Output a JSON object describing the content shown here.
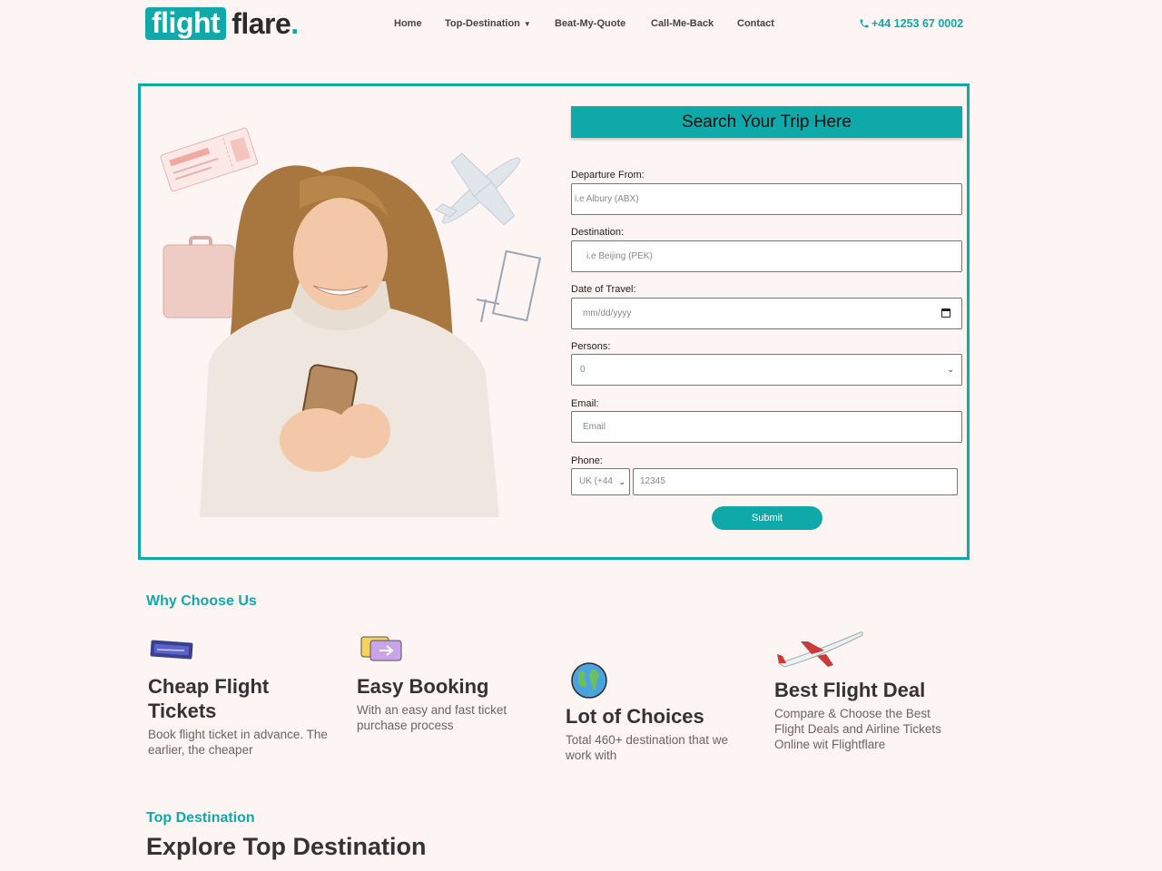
{
  "brand": {
    "logo_box": "flight",
    "logo_text": "flare",
    "logo_dot": "."
  },
  "nav": {
    "items": [
      "Home",
      "Top-Destination",
      "Beat-My-Quote",
      "Call-Me-Back",
      "Contact"
    ],
    "phone": "+44 1253 67 0002",
    "phone_icon": "phone-icon"
  },
  "form": {
    "title": "Search Your Trip Here",
    "departure_label": "Departure From:",
    "departure_placeholder": "i.e Albury (ABX)",
    "destination_label": "Destination:",
    "destination_placeholder": "i.e Beijing (PEK)",
    "date_label": "Date of Travel:",
    "date_placeholder": "mm/dd/yyyy",
    "persons_label": "Persons:",
    "persons_value": "0",
    "email_label": "Email:",
    "email_placeholder": "Email",
    "phone_label": "Phone:",
    "country_code": "UK (+44",
    "phone_placeholder": "12345",
    "submit": "Submit"
  },
  "why": {
    "title": "Why Choose Us",
    "features": [
      {
        "icon": "ticket-icon",
        "title": "Cheap Flight Tickets",
        "text": "Book flight ticket in advance. The earlier, the cheaper"
      },
      {
        "icon": "boarding-pass-icon",
        "title": "Easy Booking",
        "text": "With an easy and fast ticket purchase process"
      },
      {
        "icon": "globe-icon",
        "title": "Lot of Choices",
        "text": "Total 460+ destination that we work with"
      },
      {
        "icon": "airplane-icon",
        "title": "Best Flight Deal",
        "text": "Compare & Choose the Best Flight Deals and Airline Tickets Online wit Flightflare"
      }
    ]
  },
  "top_destination": {
    "subtitle": "Top Destination",
    "title": "Explore Top Destination"
  },
  "colors": {
    "accent": "#10a9a9",
    "background": "#fdf4f4",
    "text": "#333333"
  }
}
